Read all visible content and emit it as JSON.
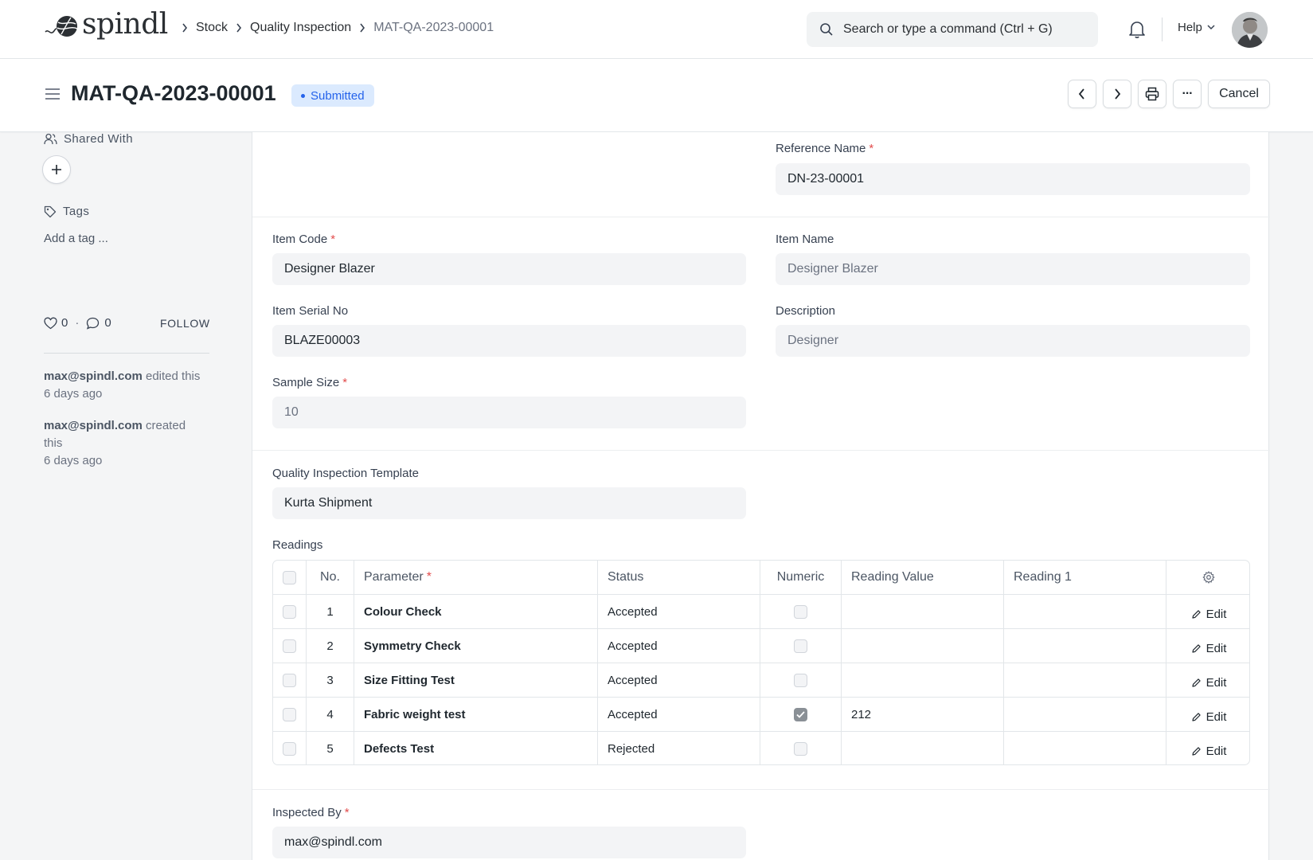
{
  "brand": {
    "name": "spindl"
  },
  "breadcrumbs": [
    "Stock",
    "Quality Inspection",
    "MAT-QA-2023-00001"
  ],
  "search": {
    "placeholder": "Search or type a command (Ctrl + G)"
  },
  "help_label": "Help",
  "header": {
    "title": "MAT-QA-2023-00001",
    "status": "Submitted",
    "cancel_label": "Cancel",
    "more_label": "···"
  },
  "sidebar": {
    "shared_with": "Shared With",
    "tags": "Tags",
    "add_tag": "Add a tag ...",
    "likes": "0",
    "comments": "0",
    "follow": "FOLLOW",
    "activity": [
      {
        "user": "max@spindl.com",
        "action": "edited this",
        "time": "6 days ago"
      },
      {
        "user": "max@spindl.com",
        "action": "created",
        "action2": "this",
        "time": "6 days ago"
      }
    ]
  },
  "form": {
    "reference_name": {
      "label": "Reference Name",
      "value": "DN-23-00001"
    },
    "item_code": {
      "label": "Item Code",
      "value": "Designer Blazer"
    },
    "item_name": {
      "label": "Item Name",
      "value": "Designer Blazer"
    },
    "item_serial_no": {
      "label": "Item Serial No",
      "value": "BLAZE00003"
    },
    "description": {
      "label": "Description",
      "value": "Designer"
    },
    "sample_size": {
      "label": "Sample Size",
      "value": "10"
    },
    "qi_template": {
      "label": "Quality Inspection Template",
      "value": "Kurta Shipment"
    },
    "readings_label": "Readings",
    "inspected_by": {
      "label": "Inspected By",
      "value": "max@spindl.com"
    }
  },
  "readings": {
    "columns": [
      "No.",
      "Parameter",
      "Status",
      "Numeric",
      "Reading Value",
      "Reading 1"
    ],
    "edit_label": "Edit",
    "rows": [
      {
        "no": "1",
        "parameter": "Colour Check",
        "status": "Accepted",
        "numeric": false,
        "reading_value": "",
        "reading_1": ""
      },
      {
        "no": "2",
        "parameter": "Symmetry Check",
        "status": "Accepted",
        "numeric": false,
        "reading_value": "",
        "reading_1": ""
      },
      {
        "no": "3",
        "parameter": "Size Fitting Test",
        "status": "Accepted",
        "numeric": false,
        "reading_value": "",
        "reading_1": ""
      },
      {
        "no": "4",
        "parameter": "Fabric weight test",
        "status": "Accepted",
        "numeric": true,
        "reading_value": "212",
        "reading_1": ""
      },
      {
        "no": "5",
        "parameter": "Defects Test",
        "status": "Rejected",
        "numeric": false,
        "reading_value": "",
        "reading_1": ""
      }
    ]
  }
}
